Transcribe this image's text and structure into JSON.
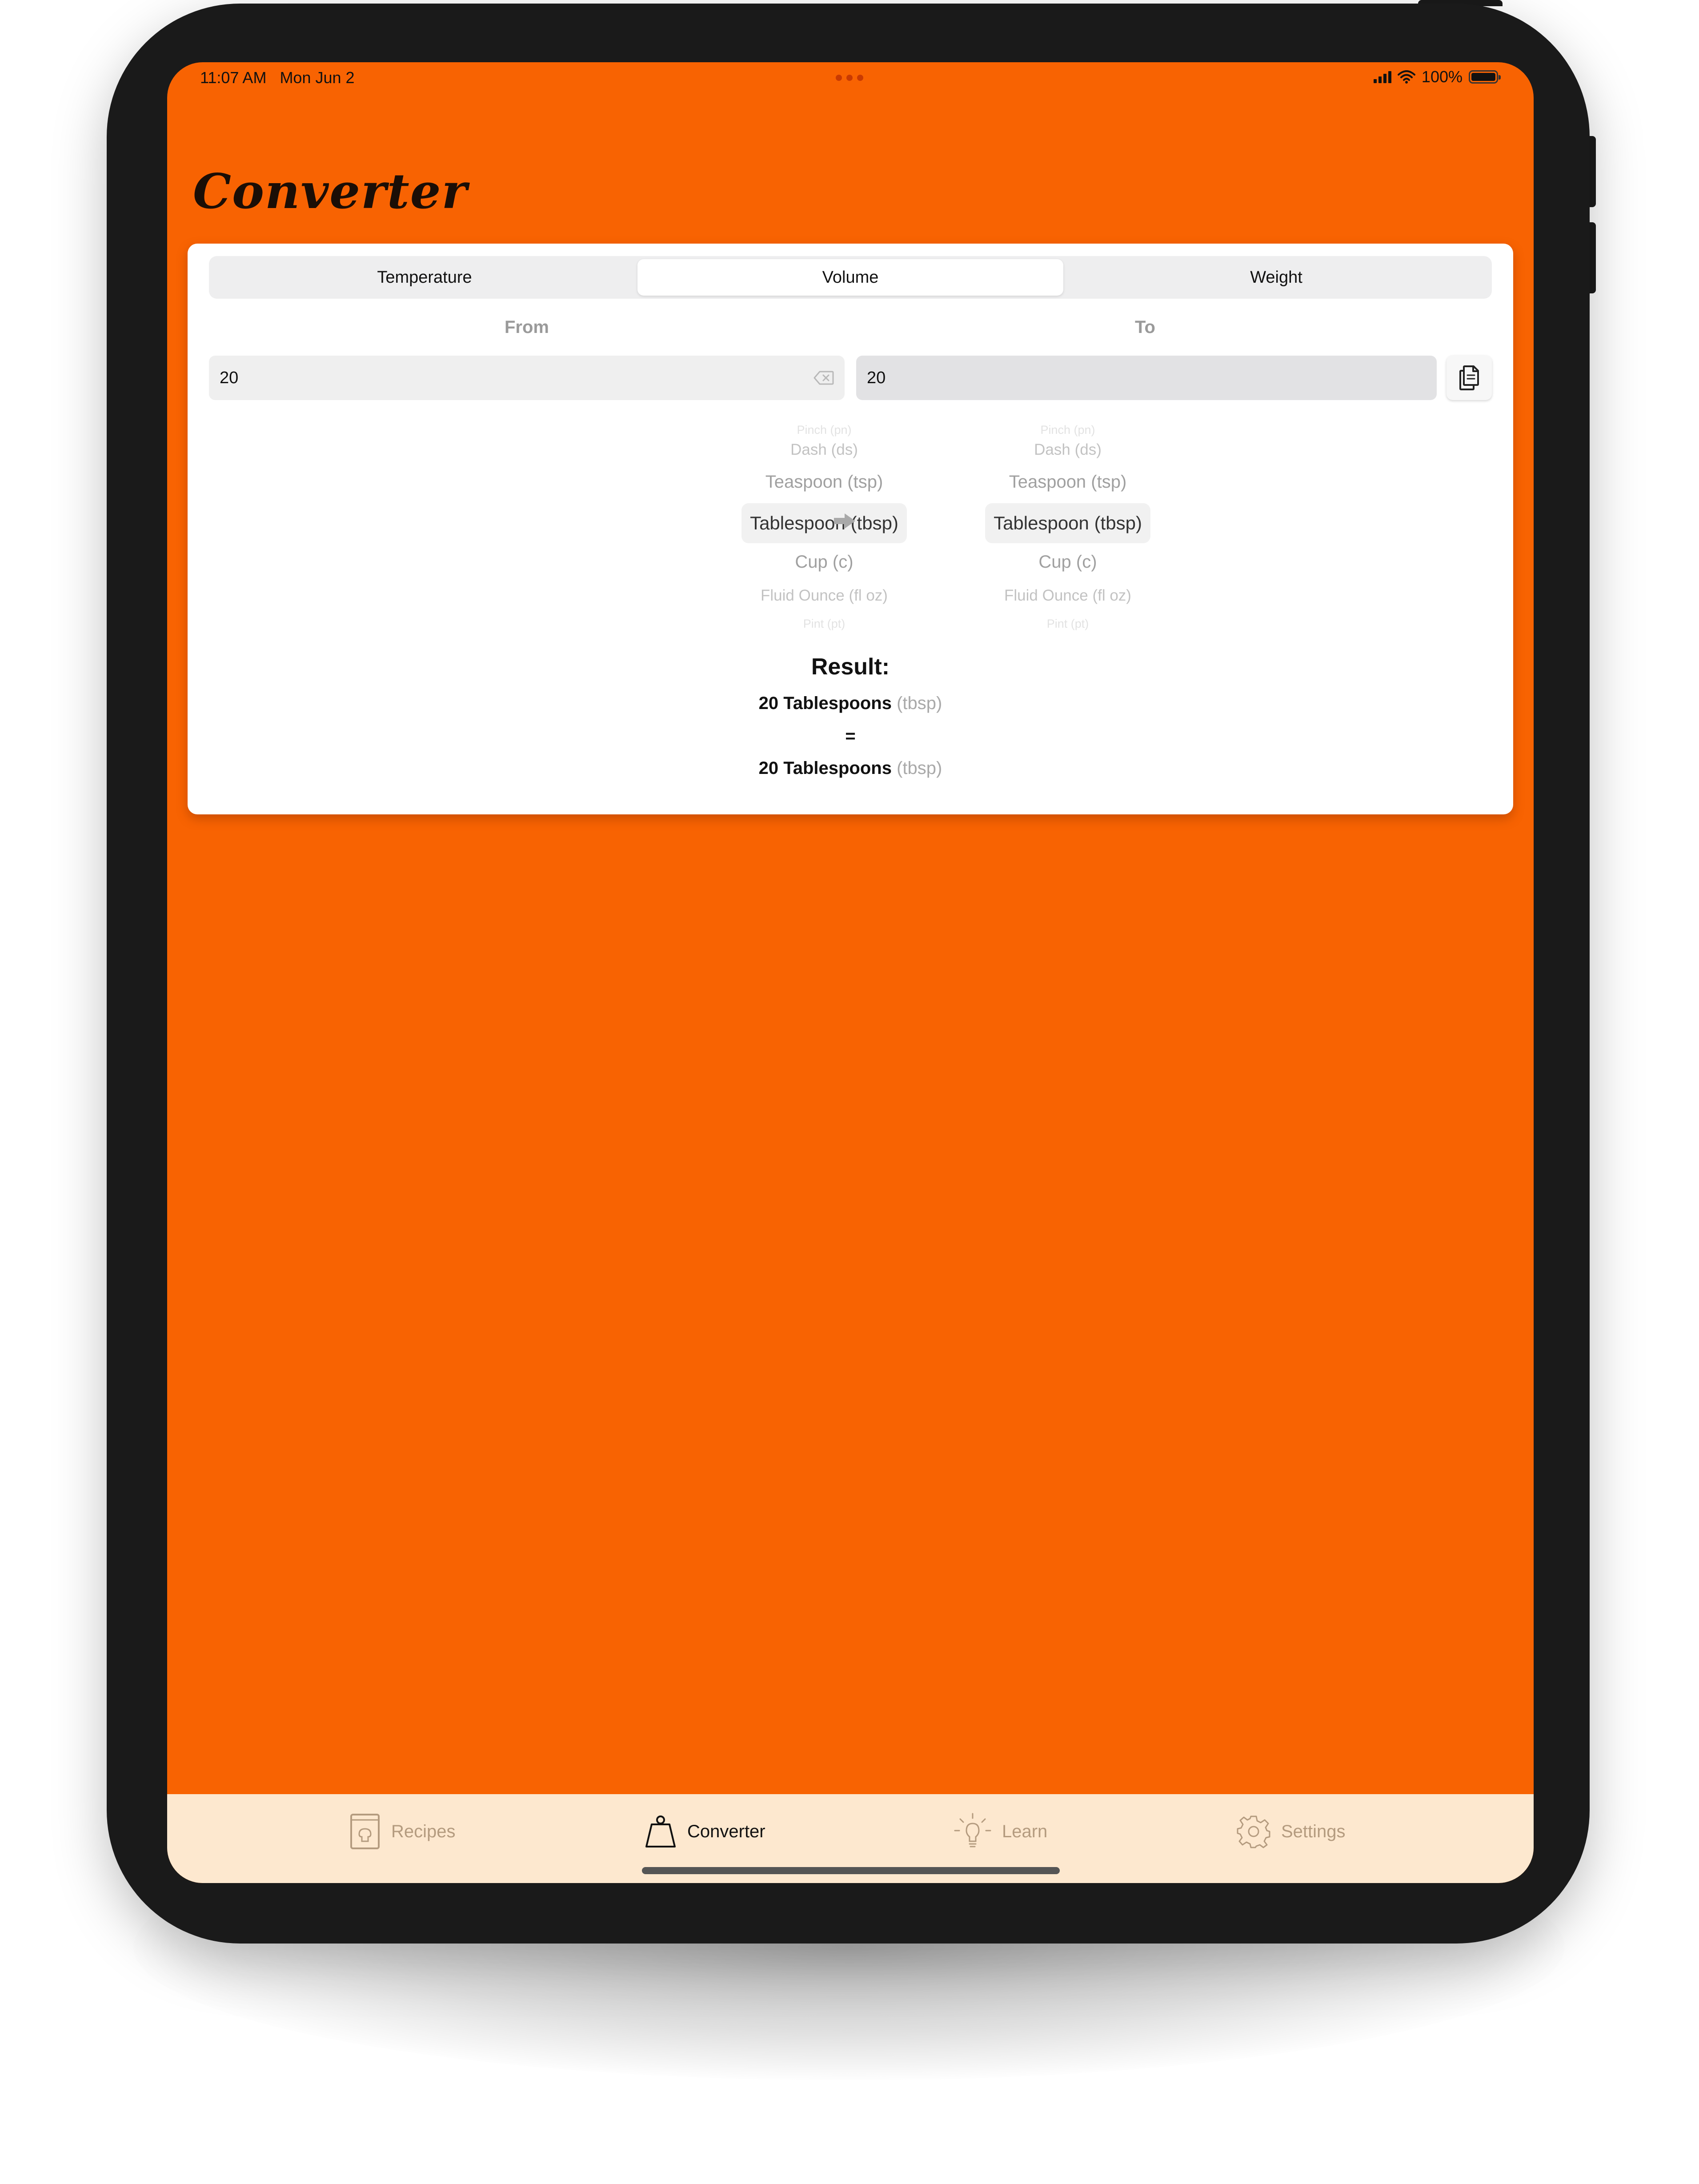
{
  "status_bar": {
    "time": "11:07 AM",
    "date": "Mon Jun 2",
    "battery": "100%",
    "battery_level": 1.0,
    "icons": [
      "cellular-signal-icon",
      "wifi-icon",
      "battery-icon"
    ]
  },
  "page": {
    "title": "Converter"
  },
  "segments": {
    "temperature": "Temperature",
    "volume": "Volume",
    "weight": "Weight",
    "selected": "Volume"
  },
  "from": {
    "label": "From",
    "value": "20",
    "units": {
      "far_above": "Pinch (pn)",
      "above_2": "Dash (ds)",
      "above_1": "Teaspoon (tsp)",
      "selected": "Tablespoon (tbsp)",
      "below_1": "Cup (c)",
      "below_2": "Fluid Ounce (fl oz)",
      "far_below": "Pint (pt)"
    }
  },
  "to": {
    "label": "To",
    "value": "20",
    "units": {
      "far_above": "Pinch (pn)",
      "above_2": "Dash (ds)",
      "above_1": "Teaspoon (tsp)",
      "selected": "Tablespoon (tbsp)",
      "below_1": "Cup (c)",
      "below_2": "Fluid Ounce (fl oz)",
      "far_below": "Pint (pt)"
    }
  },
  "result": {
    "title": "Result:",
    "line1_value": "20 Tablespoons",
    "line1_unit": "(tbsp)",
    "equals": "=",
    "line2_value": "20 Tablespoons",
    "line2_unit": "(tbsp)"
  },
  "tabs": {
    "recipes": "Recipes",
    "converter": "Converter",
    "learn": "Learn",
    "settings": "Settings",
    "active": "Converter"
  },
  "colors": {
    "background": "#f86302",
    "tabbar": "#fde8cf",
    "card": "#ffffff",
    "inactive_tab": "#b49b7f"
  }
}
